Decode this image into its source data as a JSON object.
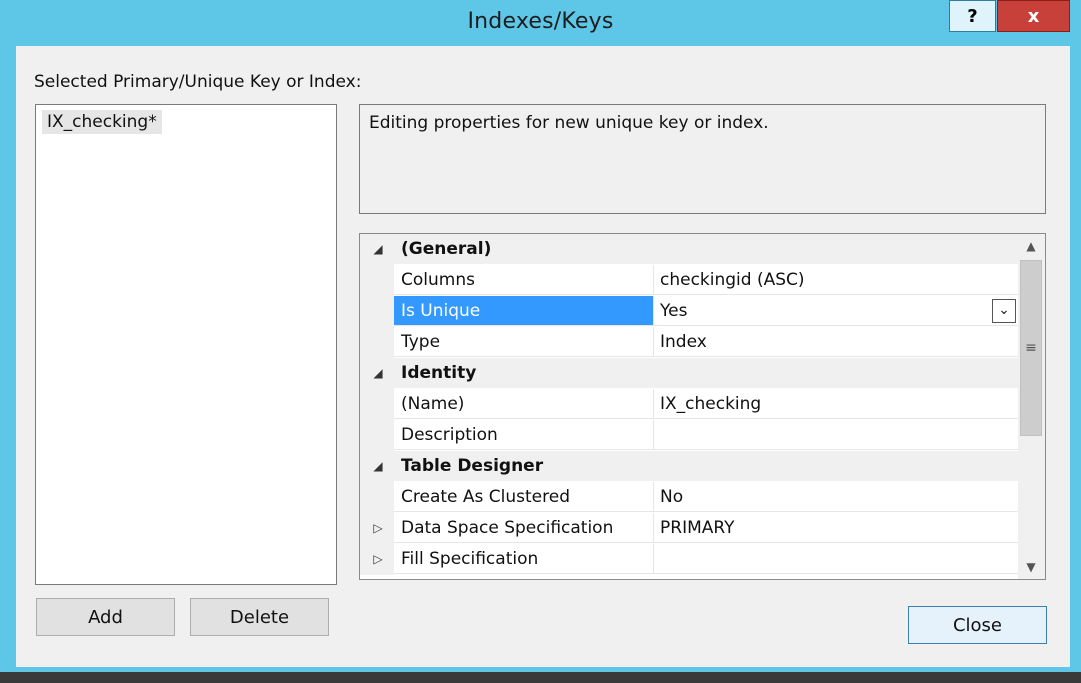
{
  "window": {
    "title": "Indexes/Keys",
    "help_label": "?",
    "close_label": "x"
  },
  "list": {
    "label": "Selected Primary/Unique Key or Index:",
    "items": [
      "IX_checking*"
    ]
  },
  "description": "Editing properties for new unique key or index.",
  "grid": {
    "rows": [
      {
        "type": "category",
        "glyph": "◢",
        "name": "(General)"
      },
      {
        "type": "prop",
        "name": "Columns",
        "value": "checkingid (ASC)"
      },
      {
        "type": "prop",
        "name": "Is Unique",
        "value": "Yes",
        "selected": true
      },
      {
        "type": "prop",
        "name": "Type",
        "value": "Index"
      },
      {
        "type": "category",
        "glyph": "◢",
        "name": "Identity"
      },
      {
        "type": "prop",
        "name": "(Name)",
        "value": "IX_checking"
      },
      {
        "type": "prop",
        "name": "Description",
        "value": ""
      },
      {
        "type": "category",
        "glyph": "◢",
        "name": "Table Designer"
      },
      {
        "type": "prop",
        "name": "Create As Clustered",
        "value": "No"
      },
      {
        "type": "prop",
        "glyph": "▷",
        "name": "Data Space Specification",
        "value": "PRIMARY"
      },
      {
        "type": "prop",
        "glyph": "▷",
        "name": "Fill Specification",
        "value": ""
      }
    ]
  },
  "buttons": {
    "add": "Add",
    "delete": "Delete",
    "close": "Close"
  },
  "colors": {
    "frame": "#5ec7e8",
    "selection": "#3399ff",
    "close_x": "#c8403a"
  }
}
